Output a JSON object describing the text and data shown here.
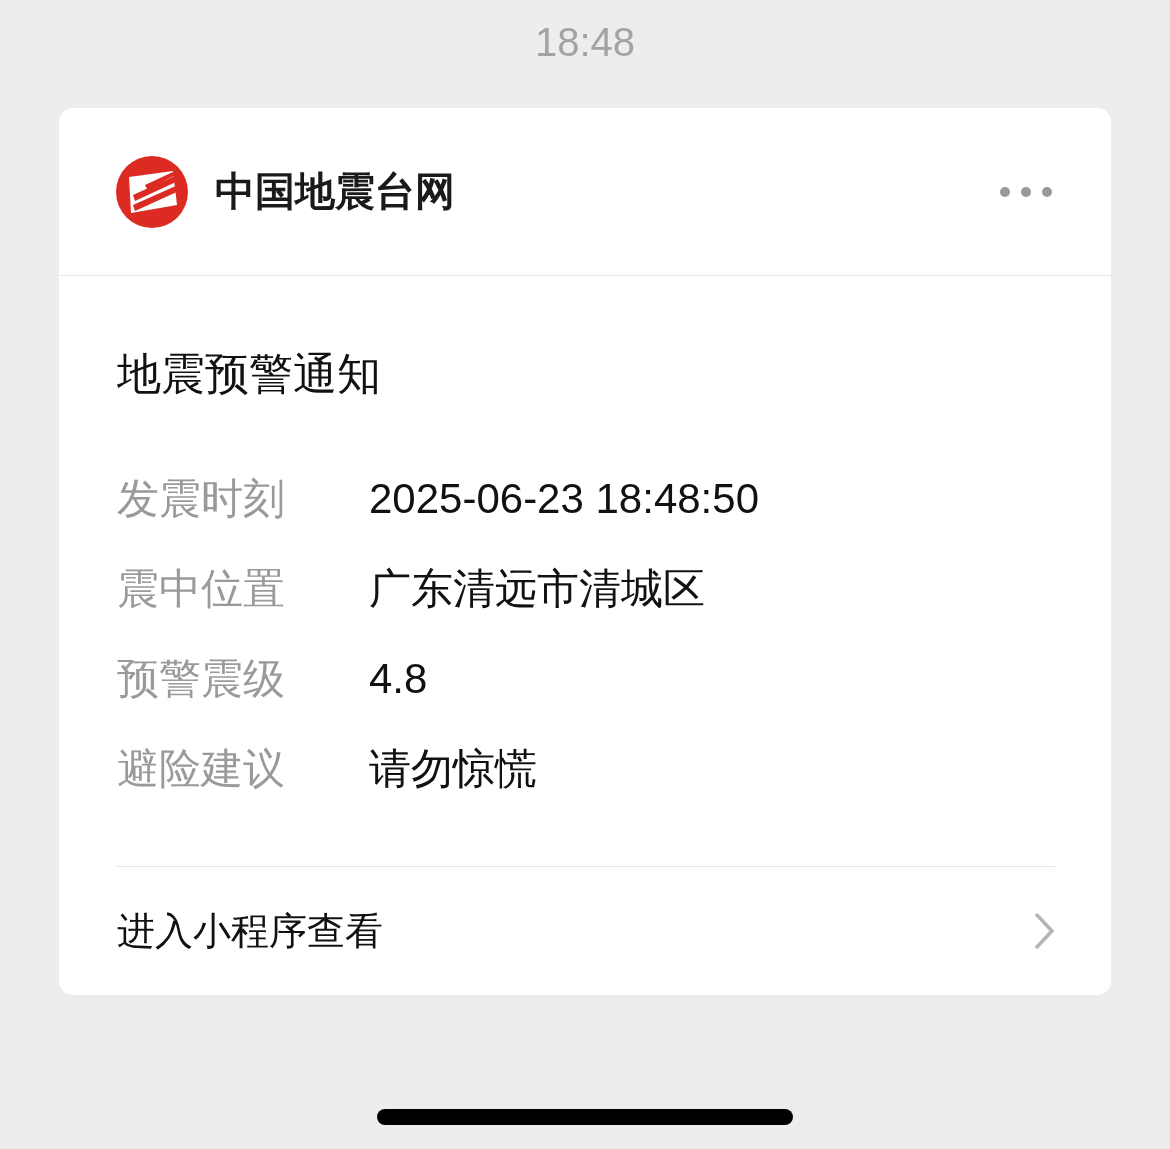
{
  "status_time": "18:48",
  "card": {
    "account_name": "中国地震台网",
    "title": "地震预警通知",
    "fields": [
      {
        "label": "发震时刻",
        "value": "2025-06-23 18:48:50"
      },
      {
        "label": "震中位置",
        "value": "广东清远市清城区"
      },
      {
        "label": "预警震级",
        "value": "4.8"
      },
      {
        "label": "避险建议",
        "value": "请勿惊慌"
      }
    ],
    "link": "进入小程序查看"
  }
}
